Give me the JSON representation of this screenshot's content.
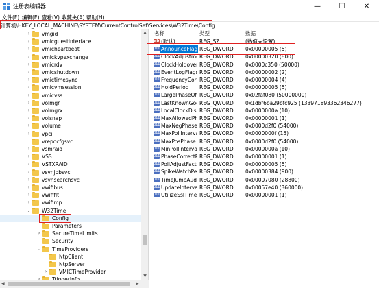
{
  "window": {
    "title": "注册表编辑器",
    "controls": {
      "minimize": "—",
      "maximize": "☐",
      "close": "✕"
    }
  },
  "menu": [
    "文件(F)",
    "编辑(E)",
    "查看(V)",
    "收藏夹(A)",
    "帮助(H)"
  ],
  "address": "计算机\\HKEY_LOCAL_MACHINE\\SYSTEM\\CurrentControlSet\\Services\\W32Time\\Config",
  "tree": {
    "items": [
      {
        "label": "vmgid",
        "level": 0,
        "expander": "›"
      },
      {
        "label": "vmicguestinterface",
        "level": 0,
        "expander": "›"
      },
      {
        "label": "vmicheartbeat",
        "level": 0,
        "expander": "›"
      },
      {
        "label": "vmickvpexchange",
        "level": 0,
        "expander": "›"
      },
      {
        "label": "vmicrdv",
        "level": 0,
        "expander": "›"
      },
      {
        "label": "vmicshutdown",
        "level": 0,
        "expander": "›"
      },
      {
        "label": "vmictimesync",
        "level": 0,
        "expander": "›"
      },
      {
        "label": "vmicvmsession",
        "level": 0,
        "expander": "›"
      },
      {
        "label": "vmicvss",
        "level": 0,
        "expander": "›"
      },
      {
        "label": "volmgr",
        "level": 0,
        "expander": "›"
      },
      {
        "label": "volmgrx",
        "level": 0,
        "expander": "›"
      },
      {
        "label": "volsnap",
        "level": 0,
        "expander": "›"
      },
      {
        "label": "volume",
        "level": 0,
        "expander": "›"
      },
      {
        "label": "vpci",
        "level": 0,
        "expander": "›"
      },
      {
        "label": "vrepocfgsvc",
        "level": 0,
        "expander": ""
      },
      {
        "label": "vsmraid",
        "level": 0,
        "expander": "›"
      },
      {
        "label": "VSS",
        "level": 0,
        "expander": "›"
      },
      {
        "label": "VSTXRAID",
        "level": 0,
        "expander": "›"
      },
      {
        "label": "vsvnjobsvc",
        "level": 0,
        "expander": "›"
      },
      {
        "label": "vsvnsearchsvc",
        "level": 0,
        "expander": "›"
      },
      {
        "label": "vwifibus",
        "level": 0,
        "expander": "›"
      },
      {
        "label": "vwififlt",
        "level": 0,
        "expander": "›"
      },
      {
        "label": "vwifimp",
        "level": 0,
        "expander": "›"
      },
      {
        "label": "W32Time",
        "level": 0,
        "expander": "⌄"
      },
      {
        "label": "Config",
        "level": 1,
        "expander": "",
        "selected": true
      },
      {
        "label": "Parameters",
        "level": 1,
        "expander": ""
      },
      {
        "label": "SecureTimeLimits",
        "level": 1,
        "expander": "›"
      },
      {
        "label": "Security",
        "level": 1,
        "expander": ""
      },
      {
        "label": "TimeProviders",
        "level": 1,
        "expander": "⌄"
      },
      {
        "label": "NtpClient",
        "level": 2,
        "expander": ""
      },
      {
        "label": "NtpServer",
        "level": 2,
        "expander": ""
      },
      {
        "label": "VMICTimeProvider",
        "level": 2,
        "expander": "›"
      },
      {
        "label": "TriggerInfo",
        "level": 1,
        "expander": "›"
      }
    ]
  },
  "values": {
    "headers": {
      "name": "名称",
      "type": "类型",
      "data": "数据"
    },
    "rows": [
      {
        "name": "(默认)",
        "type": "REG_SZ",
        "data": "(数值未设置)",
        "icon": "ab"
      },
      {
        "name": "AnnounceFlags",
        "type": "REG_DWORD",
        "data": "0x00000005 (5)",
        "icon": "bin",
        "selected": true
      },
      {
        "name": "ClockAdjustme...",
        "type": "REG_DWORD",
        "data": "0x00000320 (800)",
        "icon": "bin"
      },
      {
        "name": "ClockHoldover...",
        "type": "REG_DWORD",
        "data": "0x0000c350 (50000)",
        "icon": "bin"
      },
      {
        "name": "EventLogFlags",
        "type": "REG_DWORD",
        "data": "0x00000002 (2)",
        "icon": "bin"
      },
      {
        "name": "FrequencyCorr...",
        "type": "REG_DWORD",
        "data": "0x00000004 (4)",
        "icon": "bin"
      },
      {
        "name": "HoldPeriod",
        "type": "REG_DWORD",
        "data": "0x00000005 (5)",
        "icon": "bin"
      },
      {
        "name": "LargePhaseOff...",
        "type": "REG_DWORD",
        "data": "0x02faf080 (50000000)",
        "icon": "bin"
      },
      {
        "name": "LastKnownGoo...",
        "type": "REG_QWORD",
        "data": "0x1dbf6ba29bfc925 (133971893362346277)",
        "icon": "bin"
      },
      {
        "name": "LocalClockDis...",
        "type": "REG_DWORD",
        "data": "0x0000000a (10)",
        "icon": "bin"
      },
      {
        "name": "MaxAllowedPh...",
        "type": "REG_DWORD",
        "data": "0x00000001 (1)",
        "icon": "bin"
      },
      {
        "name": "MaxNegPhase...",
        "type": "REG_DWORD",
        "data": "0x0000d2f0 (54000)",
        "icon": "bin"
      },
      {
        "name": "MaxPollInterval",
        "type": "REG_DWORD",
        "data": "0x0000000f (15)",
        "icon": "bin"
      },
      {
        "name": "MaxPosPhase...",
        "type": "REG_DWORD",
        "data": "0x0000d2f0 (54000)",
        "icon": "bin"
      },
      {
        "name": "MinPollInterval",
        "type": "REG_DWORD",
        "data": "0x0000000a (10)",
        "icon": "bin"
      },
      {
        "name": "PhaseCorrectR...",
        "type": "REG_DWORD",
        "data": "0x00000001 (1)",
        "icon": "bin"
      },
      {
        "name": "PollAdjustFactor",
        "type": "REG_DWORD",
        "data": "0x00000005 (5)",
        "icon": "bin"
      },
      {
        "name": "SpikeWatchPer...",
        "type": "REG_DWORD",
        "data": "0x00000384 (900)",
        "icon": "bin"
      },
      {
        "name": "TimeJumpAudi...",
        "type": "REG_DWORD",
        "data": "0x00007080 (28800)",
        "icon": "bin"
      },
      {
        "name": "UpdateInterval",
        "type": "REG_DWORD",
        "data": "0x00057e40 (360000)",
        "icon": "bin"
      },
      {
        "name": "UtilizeSslTime...",
        "type": "REG_DWORD",
        "data": "0x00000001 (1)",
        "icon": "bin"
      }
    ]
  },
  "icons": {
    "ab": "ab",
    "bin": "011"
  },
  "colors": {
    "selection": "#0078d7",
    "annotation": "#e02020",
    "folder": "#f3c74b"
  }
}
